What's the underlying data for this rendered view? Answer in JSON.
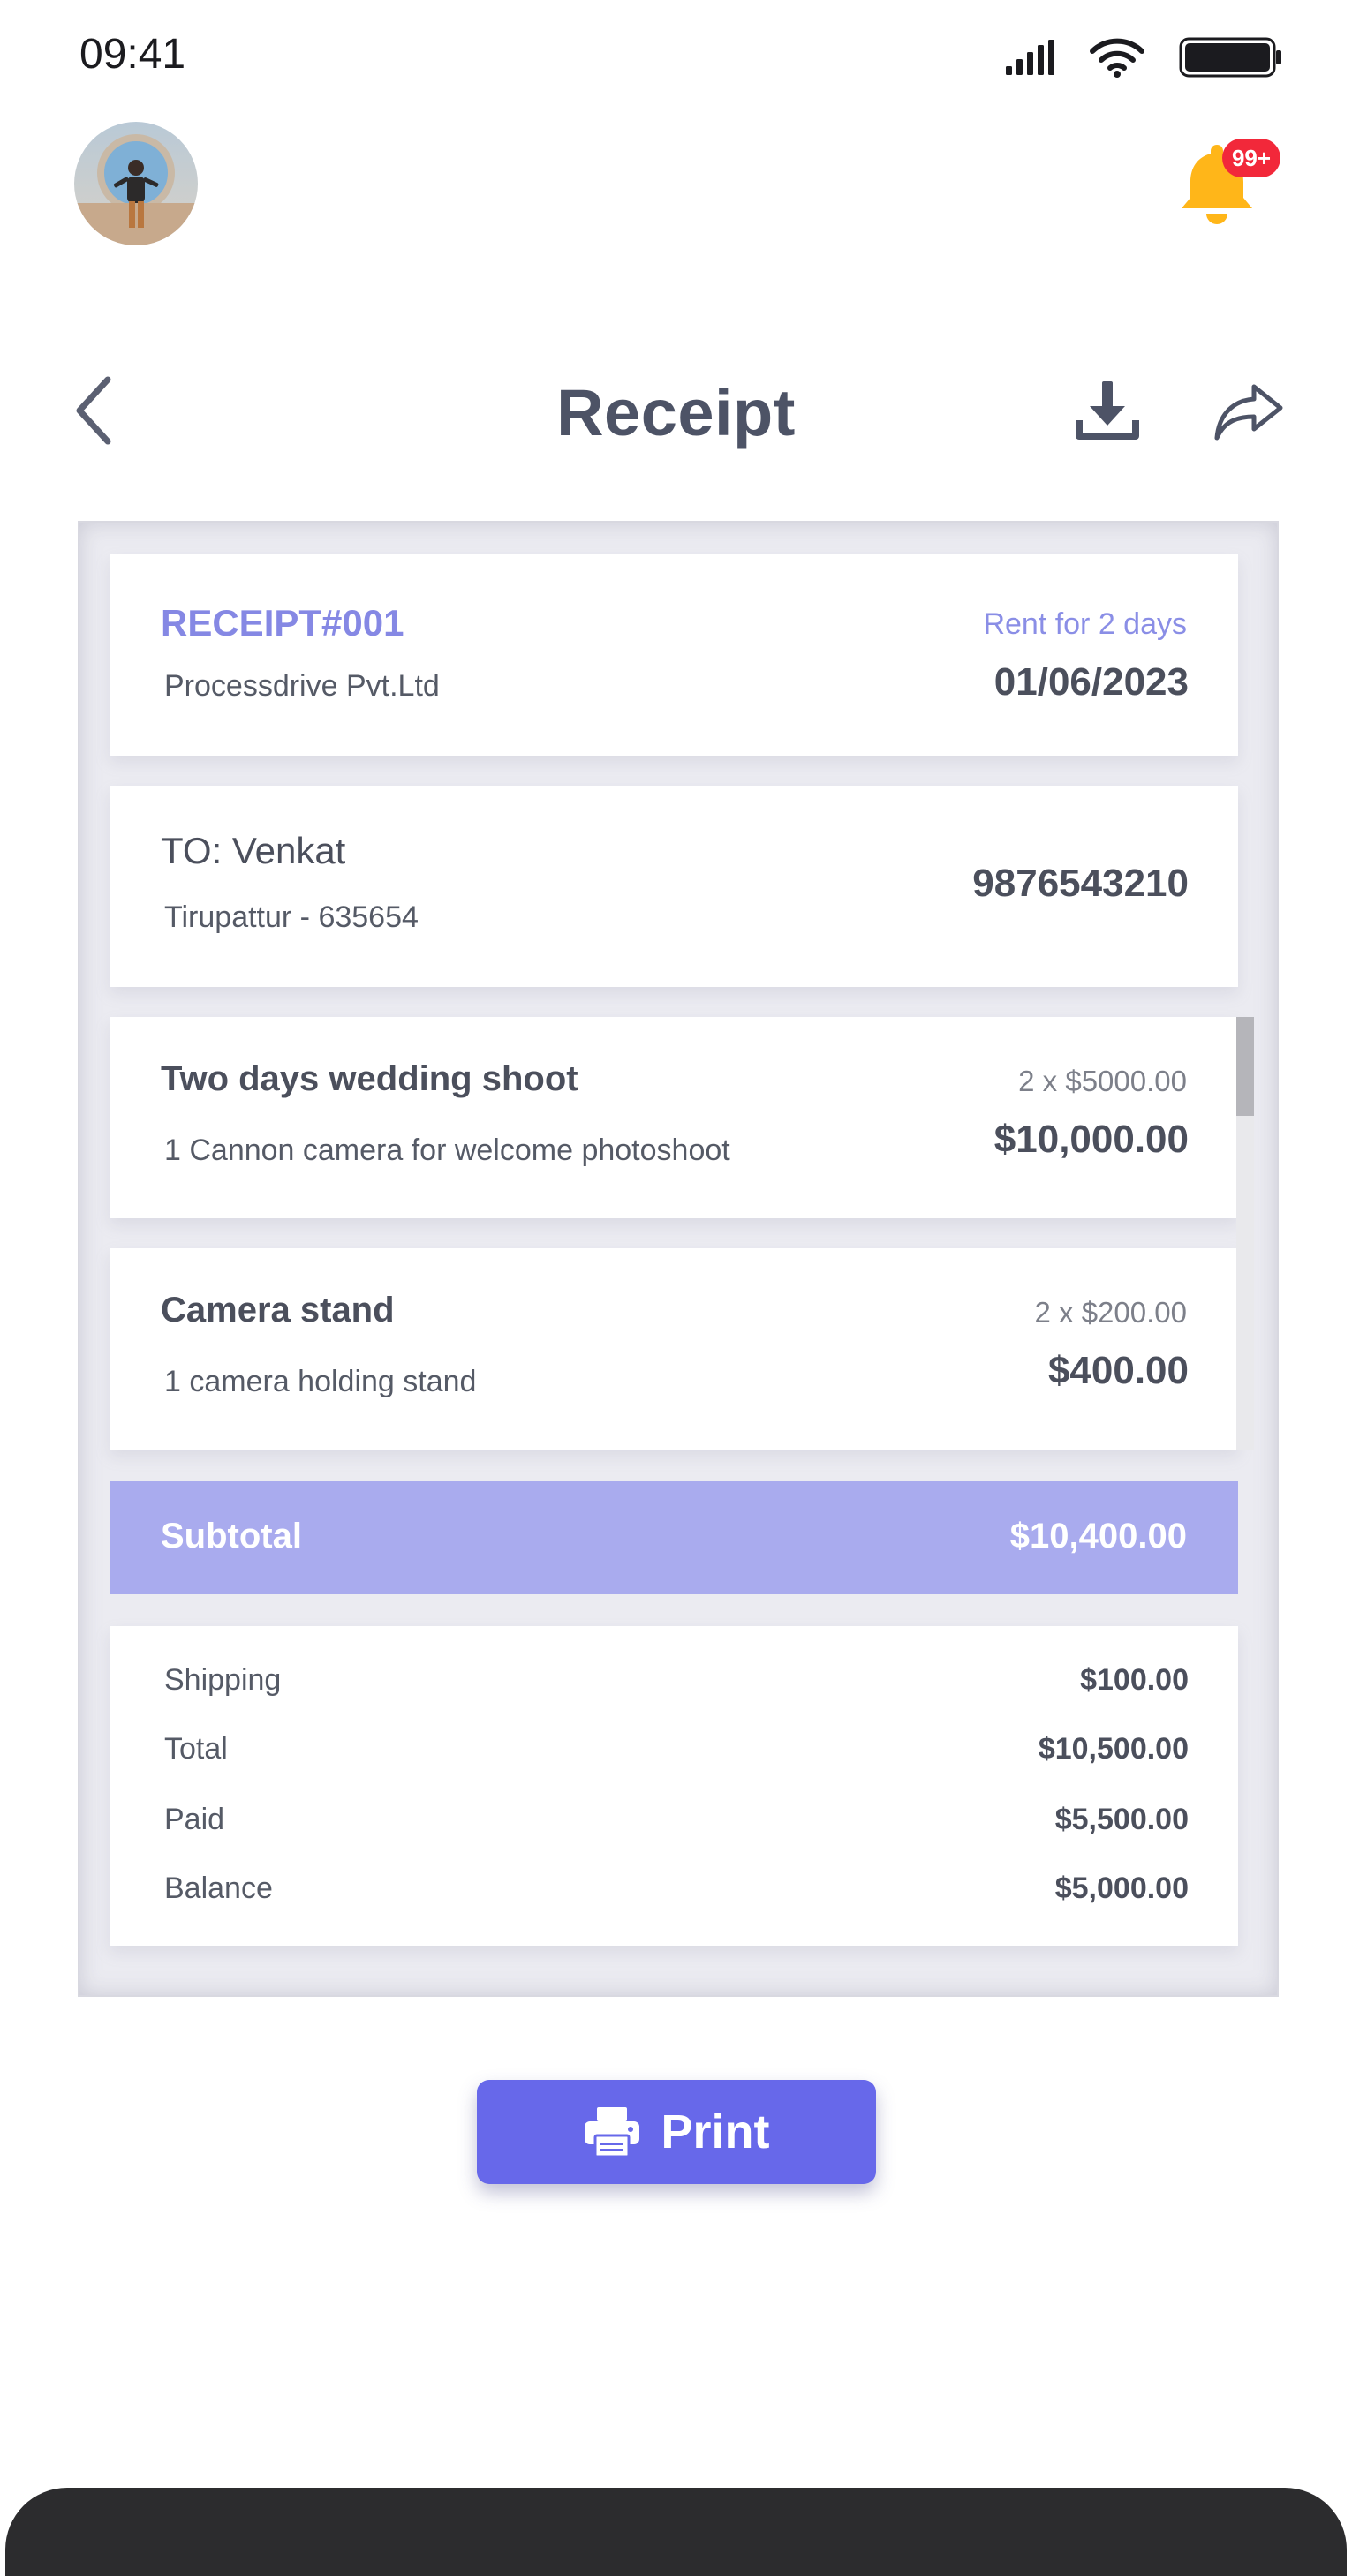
{
  "status_bar": {
    "time": "09:41"
  },
  "top_bar": {
    "notification_badge": "99+"
  },
  "header": {
    "title": "Receipt"
  },
  "receipt": {
    "number": "RECEIPT#001",
    "company": "Processdrive Pvt.Ltd",
    "rent_note": "Rent for 2 days",
    "date": "01/06/2023"
  },
  "recipient": {
    "name": "TO: Venkat",
    "address": "Tirupattur - 635654",
    "phone": "9876543210"
  },
  "items": [
    {
      "title": "Two days wedding shoot",
      "description": "1 Cannon camera for welcome photoshoot",
      "qty_price": "2 x $5000.00",
      "amount": "$10,000.00"
    },
    {
      "title": "Camera stand",
      "description": "1 camera holding stand",
      "qty_price": "2 x $200.00",
      "amount": "$400.00"
    }
  ],
  "subtotal": {
    "label": "Subtotal",
    "value": "$10,400.00"
  },
  "summary": [
    {
      "label": "Shipping",
      "value": "$100.00"
    },
    {
      "label": "Total",
      "value": "$10,500.00"
    },
    {
      "label": "Paid",
      "value": "$5,500.00"
    },
    {
      "label": "Balance",
      "value": "$5,000.00"
    }
  ],
  "print_button": {
    "label": "Print"
  },
  "colors": {
    "accent": "#6768ea",
    "accent_light": "#a9abee",
    "receipt_number": "#8588e4",
    "badge": "#f2283a",
    "bell": "#ffb619"
  },
  "icons": {
    "back": "chevron-left-icon",
    "download": "download-icon",
    "share": "share-icon",
    "notification": "bell-icon",
    "print": "printer-icon"
  }
}
